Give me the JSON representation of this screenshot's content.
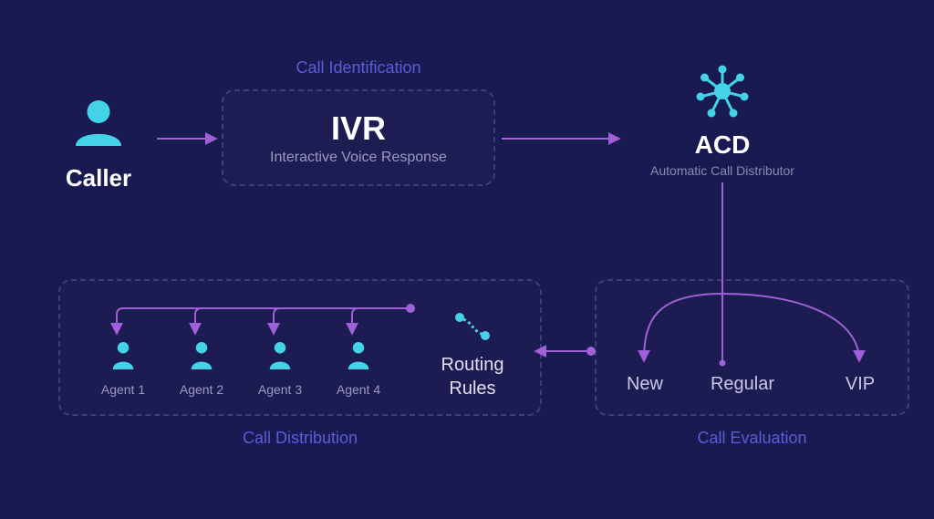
{
  "caller": {
    "label": "Caller"
  },
  "sections": {
    "identification": "Call Identification",
    "distribution": "Call Distribution",
    "evaluation": "Call Evaluation"
  },
  "ivr": {
    "title": "IVR",
    "subtitle": "Interactive Voice Response"
  },
  "acd": {
    "title": "ACD",
    "subtitle": "Automatic Call Distributor"
  },
  "routing": {
    "line1": "Routing",
    "line2": "Rules"
  },
  "agents": {
    "a1": "Agent 1",
    "a2": "Agent 2",
    "a3": "Agent 3",
    "a4": "Agent 4"
  },
  "eval_categories": {
    "new": "New",
    "regular": "Regular",
    "vip": "VIP"
  }
}
